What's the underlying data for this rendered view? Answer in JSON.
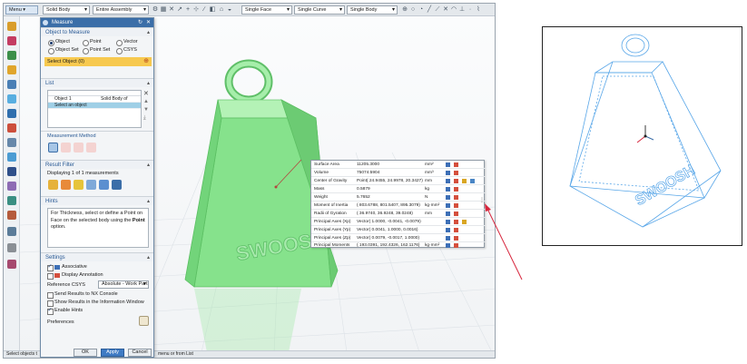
{
  "topbar": {
    "menu_label": "Menu",
    "filter1": "Solid Body",
    "filter2": "Entire Assembly",
    "filter3": "Single Face",
    "filter4": "Single Curve",
    "filter5": "Single Body"
  },
  "dialog": {
    "title": "Measure",
    "object_to_measure": {
      "header": "Object to Measure",
      "options": [
        "Object",
        "Point",
        "Vector",
        "Object Set",
        "Point Set",
        "CSYS"
      ],
      "selected_option": "Object",
      "select_prompt": "Select Object (0)"
    },
    "list": {
      "header": "List",
      "rows": [
        {
          "col1": "Object 1",
          "col2": "Solid Body of"
        },
        {
          "col1": "Select an object",
          "col2": ""
        }
      ]
    },
    "measurement_method_label": "Measurement Method",
    "result_filter": {
      "header": "Result Filter",
      "displaying": "Displaying 1 of 1 measurements"
    },
    "hints": {
      "header": "Hints",
      "text_before": "For Thickness, select or define a Point on Face on the selected body using the ",
      "text_bold": "Point",
      "text_after": " option."
    },
    "settings": {
      "header": "Settings",
      "associative": "Associative",
      "display_annotation": "Display Annotation",
      "reference_csys_label": "Reference CSYS",
      "reference_csys_value": "Absolute - Work Part",
      "send_results": "Send Results to NX Console",
      "show_results": "Show Results in the Information Window",
      "enable_hints": "Enable Hints",
      "preferences": "Preferences"
    },
    "buttons": {
      "ok": "OK",
      "apply": "Apply",
      "cancel": "Cancel"
    }
  },
  "results": [
    {
      "name": "Surface Area",
      "value": "11205.3000",
      "unit": "mm²"
    },
    {
      "name": "Volume",
      "value": "75074.5904",
      "unit": "mm³"
    },
    {
      "name": "Center of Gravity",
      "value": "Point( 24.9455, 24.9978, 20.3427)",
      "unit": "mm"
    },
    {
      "name": "Mass",
      "value": "0.5879",
      "unit": "kg"
    },
    {
      "name": "Weight",
      "value": "5.7652",
      "unit": "N"
    },
    {
      "name": "Moment of Inertia",
      "value": "( 803.6788, 801.5407, 895.3079)",
      "unit": "kg·mm²"
    },
    {
      "name": "Radii of Gyration",
      "value": "( 36.9740, 36.9248, 39.0248)",
      "unit": "mm"
    },
    {
      "name": "Principal Axes (Xp)",
      "value": "Vector( 1.0000, -0.0041, -0.0079)",
      "unit": ""
    },
    {
      "name": "Principal Axes (Yp)",
      "value": "Vector( 0.0041, 1.0000, 0.0016)",
      "unit": ""
    },
    {
      "name": "Principal Axes (Zp)",
      "value": "Vector( 0.0079, -0.0017, 1.0000)",
      "unit": ""
    },
    {
      "name": "Principal Moments",
      "value": "( 193.0391, 192.4326, 162.1176)",
      "unit": "kg·mm²"
    }
  ],
  "model_text": "SWOOSH",
  "status": {
    "left": "Select objects t",
    "right": "menu or from List"
  },
  "colors": {
    "body_green": "#86e28c",
    "wire_blue": "#58a6e8",
    "title_blue": "#3b6ea8",
    "arrow_red": "#d7263d"
  }
}
